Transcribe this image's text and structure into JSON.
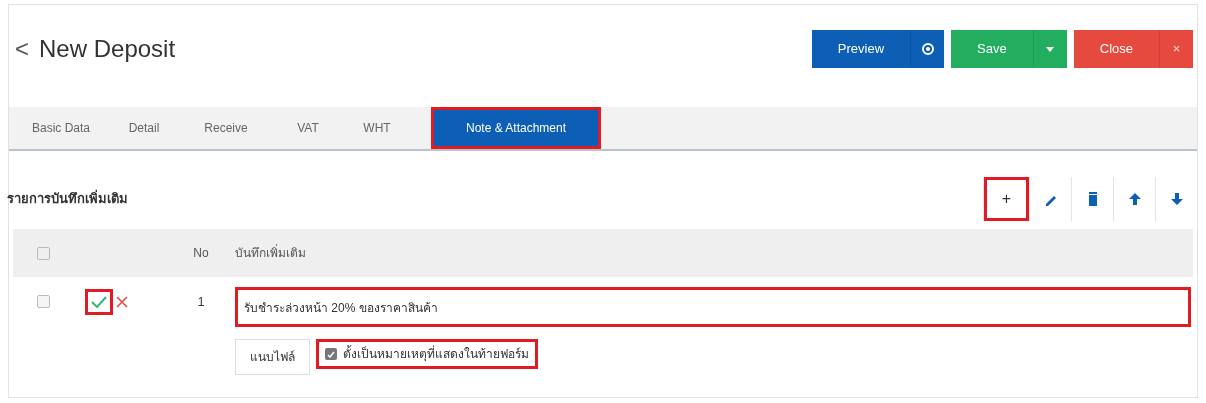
{
  "header": {
    "back": "<",
    "title": "New Deposit"
  },
  "actions": [
    {
      "kind": "preview",
      "label": "Preview"
    },
    {
      "kind": "save",
      "label": "Save"
    },
    {
      "kind": "close",
      "label": "Close",
      "icon_text": "×"
    }
  ],
  "tabs": [
    {
      "label": "Basic Data",
      "selected": false,
      "highlighted": false
    },
    {
      "label": "Detail",
      "selected": false,
      "highlighted": false
    },
    {
      "label": "Receive",
      "selected": false,
      "highlighted": false
    },
    {
      "label": "VAT",
      "selected": false,
      "highlighted": false
    },
    {
      "label": "WHT",
      "selected": false,
      "highlighted": false
    },
    {
      "label": "Note & Attachment",
      "selected": true,
      "highlighted": true
    }
  ],
  "section": {
    "title": "รายการบันทึกเพิ่มเติม"
  },
  "toolbar": [
    {
      "kind": "add",
      "label": "+",
      "highlighted": true
    },
    {
      "kind": "edit",
      "highlighted": false
    },
    {
      "kind": "delete",
      "highlighted": false
    },
    {
      "kind": "up",
      "highlighted": false
    },
    {
      "kind": "down",
      "highlighted": false
    }
  ],
  "table": {
    "columns": [
      "No",
      "บันทึกเพิ่มเติม"
    ],
    "header_checked": false,
    "rows": [
      {
        "checked": false,
        "confirm_highlighted": true,
        "no": "1",
        "note": "รับชำระล่วงหน้า 20% ของราคาสินค้า",
        "note_highlighted": true,
        "attach_label": "แนบไฟล์",
        "footer_option": {
          "label": "ตั้งเป็นหมายเหตุที่แสดงในท้ายฟอร์ม",
          "checked": true,
          "highlighted": true
        }
      }
    ]
  }
}
